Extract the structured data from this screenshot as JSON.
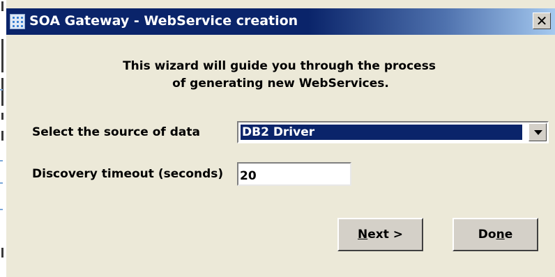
{
  "window": {
    "title": "SOA Gateway - WebService creation",
    "close_symbol": "✕"
  },
  "intro": {
    "line1": "This wizard will guide you through the process",
    "line2": "of generating new WebServices."
  },
  "form": {
    "source_label": "Select the source of data",
    "source_selected": "DB2 Driver",
    "timeout_label": "Discovery timeout (seconds)",
    "timeout_value": "20"
  },
  "buttons": {
    "next_mnemonic": "N",
    "next_rest": "ext >",
    "done_prefix": "Do",
    "done_mnemonic": "n",
    "done_rest": "e"
  },
  "icons": {
    "title_icon": "app-grid-icon",
    "dropdown": "chevron-down-icon"
  },
  "colors": {
    "title_bar": "#0a246a",
    "selection": "#0a246a",
    "dialog_face": "#ece9d8"
  }
}
